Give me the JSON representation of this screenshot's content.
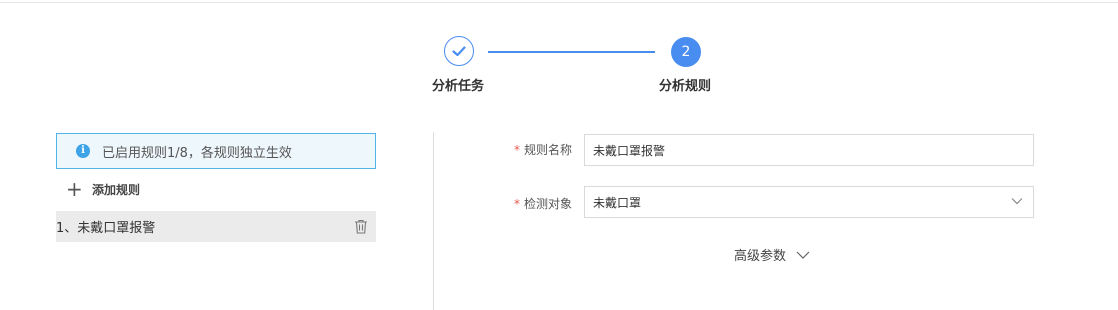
{
  "steps": [
    {
      "label": "分析任务",
      "status": "done",
      "icon": "check-icon"
    },
    {
      "label": "分析规则",
      "number": "2",
      "status": "active"
    }
  ],
  "left_panel": {
    "info_text": "已启用规则1/8，各规则独立生效",
    "info_icon_glyph": "i",
    "add_rule_label": "添加规则",
    "add_icon_glyph": "+",
    "rules": [
      {
        "label": "1、未戴口罩报警"
      }
    ]
  },
  "form": {
    "rule_name_label": "规则名称",
    "rule_name_value": "未戴口罩报警",
    "detect_target_label": "检测对象",
    "detect_target_value": "未戴口罩",
    "required_mark": "*",
    "advanced_label": "高级参数"
  },
  "colors": {
    "accent": "#4a8df0",
    "info_border": "#50b5e6",
    "info_bg": "#eef7fc",
    "required": "#e85a4f",
    "selected_row": "#ebebeb"
  }
}
